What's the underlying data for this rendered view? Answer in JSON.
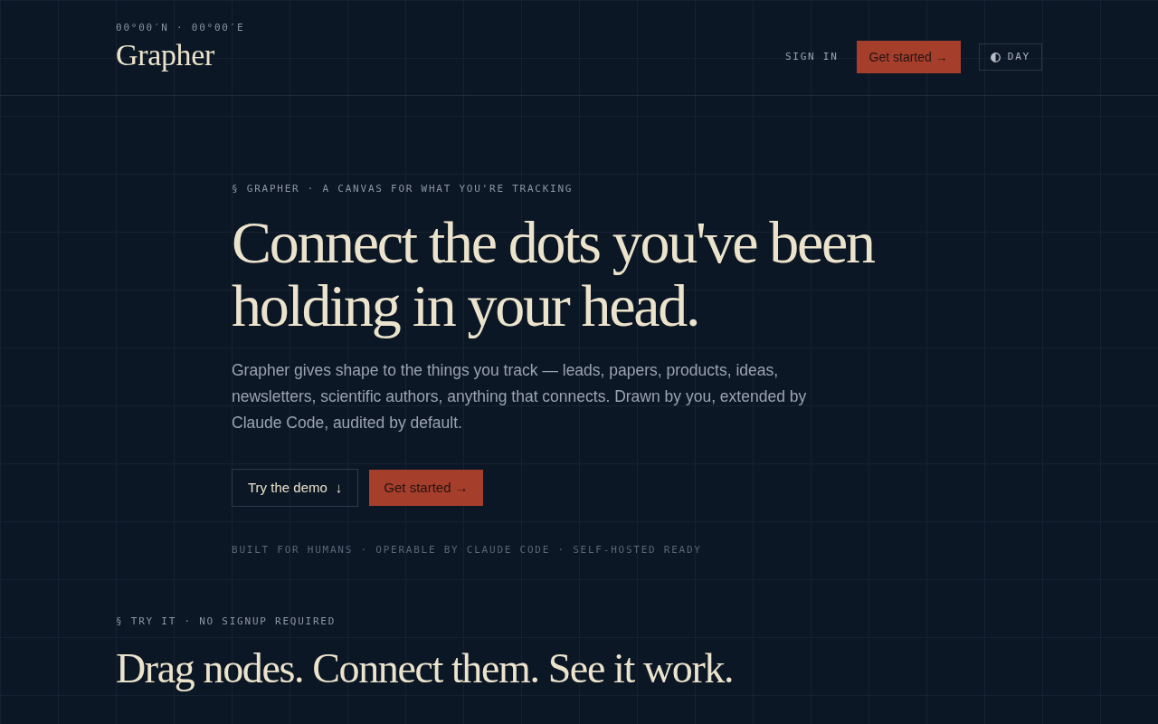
{
  "header": {
    "coordinates": "00°00′N · 00°00′E",
    "logo": "Grapher",
    "sign_in": "SIGN IN",
    "cta": {
      "kind": "primary",
      "label": "Get started",
      "arrow": "→"
    },
    "theme_toggle": {
      "label": "DAY"
    }
  },
  "hero": {
    "eyebrow": "§ GRAPHER · A CANVAS FOR WHAT YOU'RE TRACKING",
    "headline": "Connect the dots you've been holding in your head.",
    "description": "Grapher gives shape to the things you track — leads, papers, products, ideas, newsletters, scientific authors, anything that connects. Drawn by you, extended by Claude Code, audited by default.",
    "buttons": [
      {
        "kind": "outline",
        "label": "Try the demo",
        "arrow": "↓"
      },
      {
        "kind": "primary",
        "label": "Get started",
        "arrow": "→"
      }
    ],
    "tagline": "BUILT FOR HUMANS · OPERABLE BY CLAUDE CODE · SELF-HOSTED READY"
  },
  "demo_section": {
    "eyebrow": "§ TRY IT · NO SIGNUP REQUIRED",
    "heading": "Drag nodes. Connect them. See it work."
  }
}
